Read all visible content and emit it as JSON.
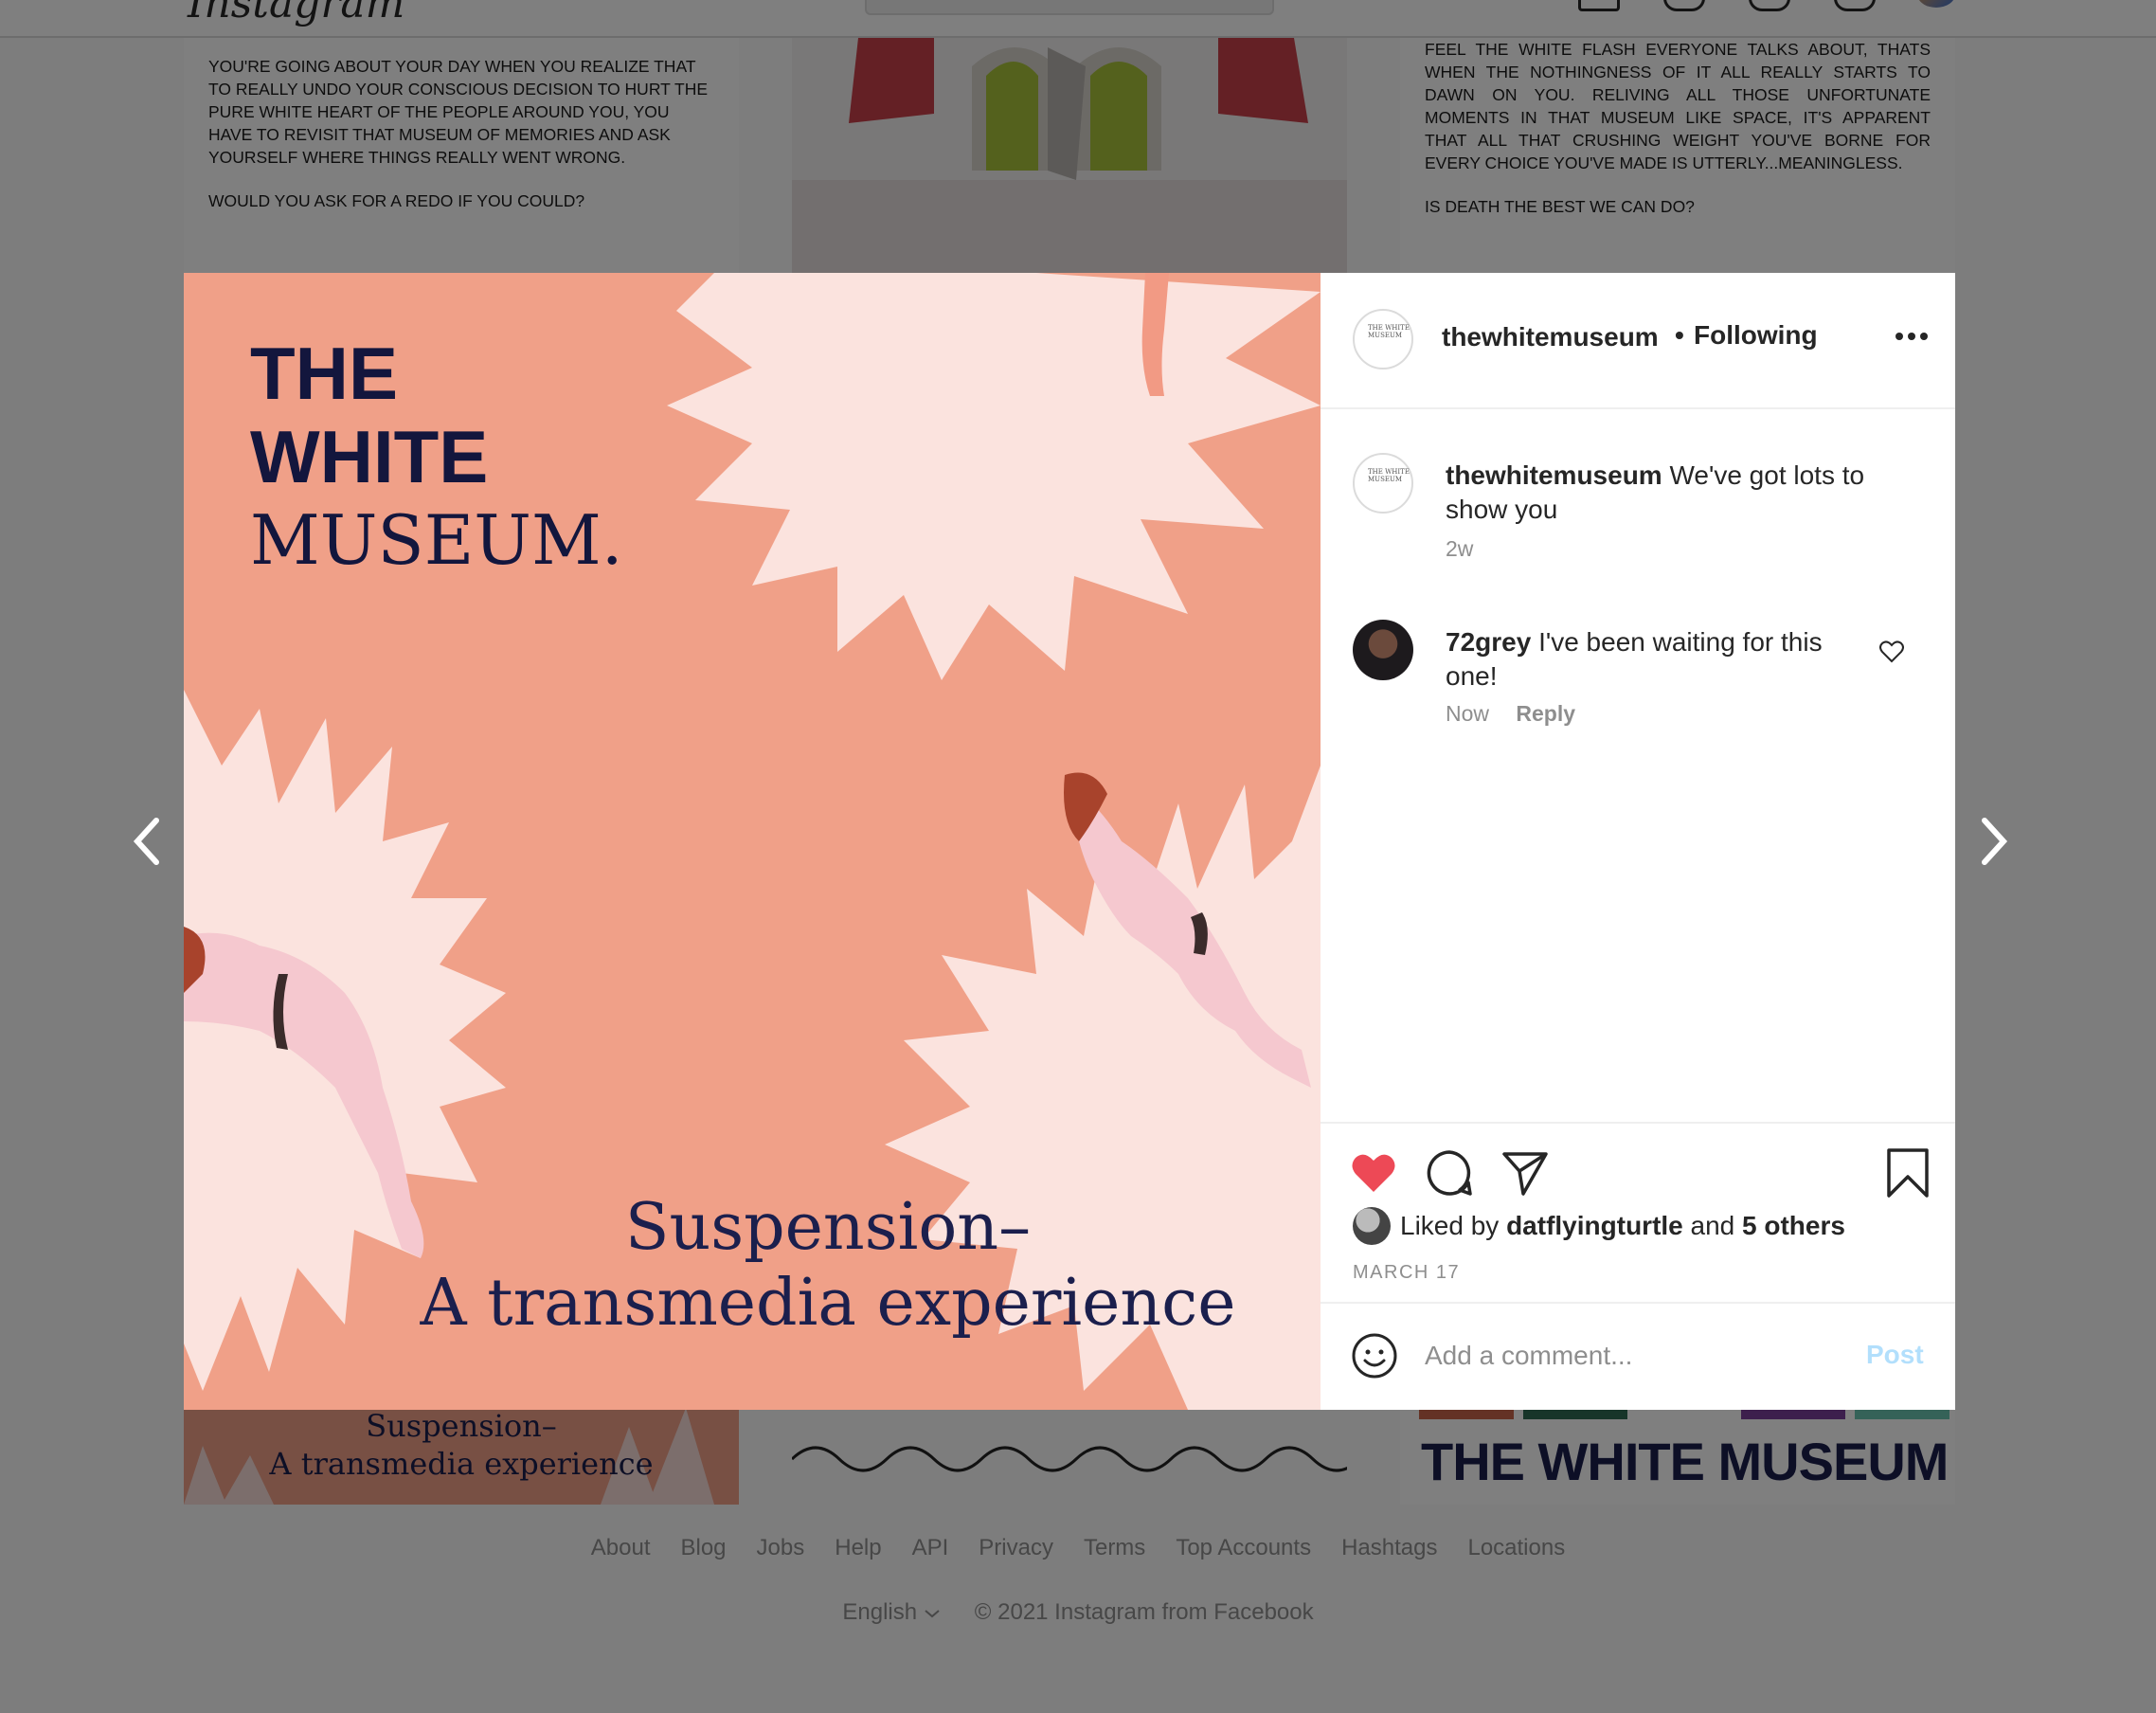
{
  "background": {
    "logo_text": "Instagram",
    "tile_top_left": {
      "paragraph_1": "YOU'RE GOING ABOUT YOUR DAY WHEN YOU REALIZE THAT TO REALLY UNDO YOUR CONSCIOUS DECISION TO HURT THE PURE WHITE HEART OF THE PEOPLE AROUND YOU, YOU HAVE TO REVISIT THAT MUSEUM OF MEMORIES AND ASK YOURSELF WHERE THINGS REALLY WENT WRONG.",
      "paragraph_2": "WOULD YOU ASK FOR A REDO IF YOU COULD?"
    },
    "tile_top_right": {
      "paragraph_1": "FEEL THE WHITE FLASH EVERYONE TALKS ABOUT, THATS WHEN THE NOTHINGNESS OF IT ALL REALLY STARTS TO DAWN ON YOU. RELIVING ALL THOSE UNFORTUNATE MOMENTS IN THAT MUSEUM LIKE SPACE, IT'S APPARENT THAT ALL THAT CRUSHING WEIGHT YOU'VE BORNE FOR EVERY CHOICE YOU'VE MADE IS UTTERLY...MEANINGLESS.",
      "paragraph_2": "IS DEATH THE BEST WE CAN DO?"
    },
    "tile_bottom_left": {
      "line_1": "Suspension–",
      "line_2": "A transmedia experience"
    },
    "tile_bottom_right": {
      "title": "THE WHITE MUSEUM"
    },
    "footer": {
      "links": [
        "About",
        "Blog",
        "Jobs",
        "Help",
        "API",
        "Privacy",
        "Terms",
        "Top Accounts",
        "Hashtags",
        "Locations"
      ],
      "language": "English",
      "copyright": "© 2021 Instagram from Facebook"
    }
  },
  "post": {
    "media": {
      "title_lines": [
        "THE",
        "WHITE",
        "MUSEUM."
      ],
      "subtitle_lines": [
        "Suspension–",
        "A transmedia experience"
      ]
    },
    "header": {
      "avatar_text": "THE WHITE MUSEUM",
      "username": "thewhitemuseum",
      "separator": "•",
      "follow_status": "Following"
    },
    "caption": {
      "username": "thewhitemuseum",
      "text": "We've got lots to show you",
      "time": "2w"
    },
    "comments": [
      {
        "username": "72grey",
        "text": "I've been waiting for this one!",
        "time": "Now",
        "reply_label": "Reply"
      }
    ],
    "likes": {
      "prefix": "Liked by",
      "liker": "datflyingturtle",
      "joiner": "and",
      "others": "5 others",
      "liked": true
    },
    "date": "MARCH 17",
    "comment_box": {
      "placeholder": "Add a comment...",
      "post_label": "Post"
    }
  },
  "colors": {
    "like_red": "#ed4956",
    "post_blue_disabled": "#b2dffc",
    "media_salmon": "#f0a088",
    "media_navy": "#13163d"
  }
}
